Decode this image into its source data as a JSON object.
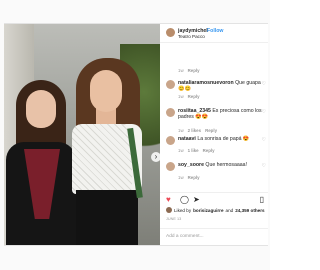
{
  "post": {
    "username": "jaydymichel",
    "separator": "•",
    "follow_label": "Follow",
    "location": "Teatro Pacco"
  },
  "comments": [
    {
      "user": "",
      "text": "",
      "time": "1w",
      "likes": "",
      "reply": "Reply"
    },
    {
      "user": "nataliaramosnuevoron",
      "text": "Que guapa 😊😊",
      "time": "1w",
      "likes": "",
      "reply": "Reply"
    },
    {
      "user": "rosiitaa_2345",
      "text": "Es preciosa como los padres 😍😍",
      "time": "1w",
      "likes": "2 likes",
      "reply": "Reply"
    },
    {
      "user": "nataavi",
      "text": "La sonrisa de papá 😍",
      "time": "1w",
      "likes": "1 like",
      "reply": "Reply"
    },
    {
      "user": "soy_soore",
      "text": "Que hermosaaaa!",
      "time": "1w",
      "likes": "",
      "reply": "Reply"
    }
  ],
  "actions": {
    "like_icon": "heart-icon",
    "comment_icon": "comment-icon",
    "share_icon": "share-icon",
    "save_icon": "bookmark-icon"
  },
  "likes": {
    "prefix": "Liked by",
    "first_user": "borisizaguirre",
    "connector": "and",
    "count": "24,359 others"
  },
  "time_ago": "JUNE 13",
  "add_comment_placeholder": "Add a comment...",
  "colors": {
    "link": "#3897f0",
    "like": "#ed4956",
    "muted": "#999999"
  }
}
